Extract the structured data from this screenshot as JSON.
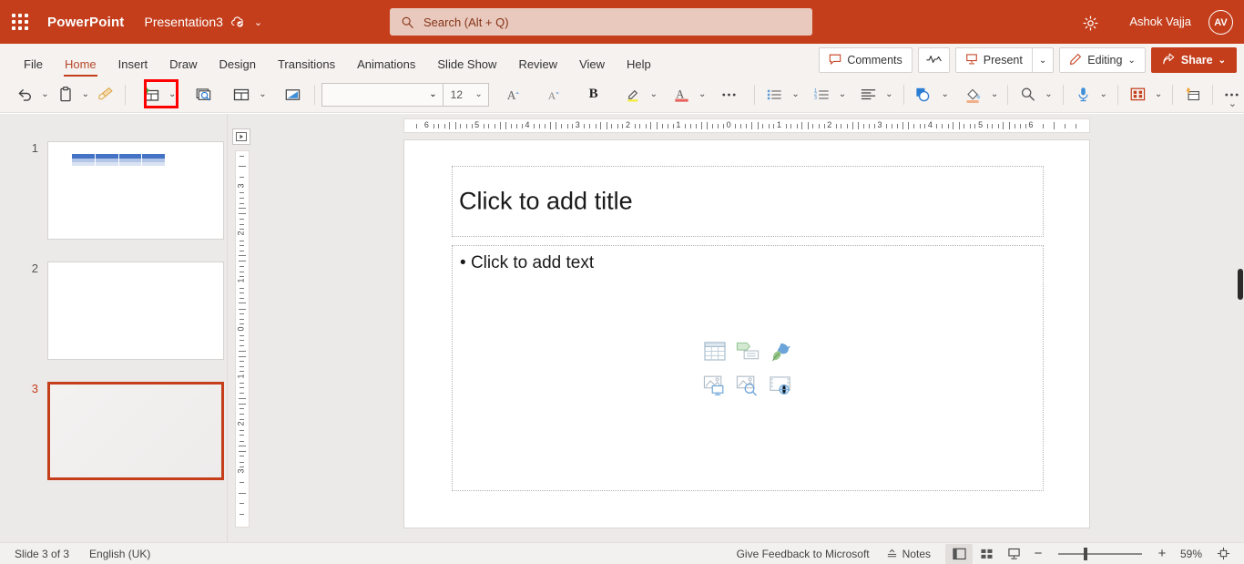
{
  "titlebar": {
    "app_name": "PowerPoint",
    "document_name": "Presentation3",
    "cloud_status_icon": "cloud-saved-icon",
    "title_chevron": "⌄",
    "search": {
      "placeholder": "Search (Alt + Q)",
      "icon": "search-icon"
    },
    "settings_icon": "gear-icon",
    "user_name": "Ashok Vajja",
    "avatar_initials": "AV"
  },
  "ribbon": {
    "tabs": [
      {
        "label": "File",
        "active": false
      },
      {
        "label": "Home",
        "active": true
      },
      {
        "label": "Insert",
        "active": false
      },
      {
        "label": "Draw",
        "active": false
      },
      {
        "label": "Design",
        "active": false
      },
      {
        "label": "Transitions",
        "active": false
      },
      {
        "label": "Animations",
        "active": false
      },
      {
        "label": "Slide Show",
        "active": false
      },
      {
        "label": "Review",
        "active": false
      },
      {
        "label": "View",
        "active": false
      },
      {
        "label": "Help",
        "active": false
      }
    ],
    "right_buttons": {
      "comments": "Comments",
      "activity_icon": "activity-pulse-icon",
      "present": "Present",
      "present_chevron": "⌄",
      "editing": "Editing",
      "editing_chevron": "⌄",
      "share": "Share",
      "share_chevron": "⌄"
    },
    "collapse_chevron": "⌄"
  },
  "toolbar": {
    "items": [
      {
        "name": "undo-button",
        "icon": "undo-icon",
        "has_dropdown": true
      },
      {
        "name": "paste-button",
        "icon": "clipboard-icon",
        "has_dropdown": true
      },
      {
        "name": "format-painter-button",
        "icon": "paintbrush-icon",
        "has_dropdown": false
      },
      {
        "name": "new-slide-button",
        "icon": "new-slide-icon",
        "has_dropdown": true,
        "highlighted": true
      },
      {
        "name": "reuse-slides-button",
        "icon": "slide-search-icon",
        "has_dropdown": false
      },
      {
        "name": "layout-button",
        "icon": "slide-layout-icon",
        "has_dropdown": true
      },
      {
        "name": "reset-button",
        "icon": "reset-slide-icon",
        "has_dropdown": false
      }
    ],
    "font_name": "",
    "font_size": "12",
    "grow_font_icon": "increase-font-size-icon",
    "shrink_font_icon": "decrease-font-size-icon",
    "bold_label": "B",
    "highlight_icon": "text-highlight-icon",
    "font_color_icon": "font-color-icon",
    "more_font_icon": "more-options-ellipsis",
    "bullets_icon": "bullet-list-icon",
    "numbering_icon": "numbered-list-icon",
    "align_icon": "align-left-icon",
    "shapes_icon": "shapes-icon",
    "fill_icon": "shape-fill-icon",
    "find_icon": "find-icon",
    "dictate_icon": "microphone-icon",
    "designer_icon": "designer-grid-icon",
    "record_icon": "record-slideshow-icon",
    "more_icon": "more-options-ellipsis"
  },
  "thumbnails": {
    "slides": [
      {
        "number": "1",
        "selected": false,
        "has_table": true
      },
      {
        "number": "2",
        "selected": false,
        "has_table": false
      },
      {
        "number": "3",
        "selected": true,
        "has_table": false
      }
    ]
  },
  "rulers": {
    "horizontal_labels": [
      "6",
      "5",
      "4",
      "3",
      "2",
      "1",
      "0",
      "1",
      "2",
      "3",
      "4",
      "5",
      "6"
    ],
    "vertical_labels": [
      "3",
      "2",
      "1",
      "0",
      "1",
      "2",
      "3"
    ],
    "ruler_toggle_icon": "ruler-toggle-icon"
  },
  "slide": {
    "title_placeholder": "Click to add title",
    "body_bullet": "•",
    "body_placeholder": "Click to add text",
    "content_icons": [
      "insert-table-icon",
      "insert-smartart-icon",
      "insert-icons-icon",
      "insert-3d-model-icon",
      "insert-stock-images-icon",
      "insert-video-icon"
    ]
  },
  "statusbar": {
    "slide_count": "Slide 3 of 3",
    "language": "English (UK)",
    "feedback": "Give Feedback to Microsoft",
    "notes_label": "Notes",
    "notes_icon": "notes-icon",
    "view_normal_icon": "normal-view-icon",
    "view_sorter_icon": "slide-sorter-icon",
    "view_reading_icon": "reading-view-icon",
    "zoom_out_label": "−",
    "zoom_in_label": "+",
    "zoom_value": "59%",
    "fit_slide_icon": "fit-slide-to-window-icon"
  },
  "colors": {
    "brand": "#c43e1c",
    "accent_text": "#b7472a",
    "highlight_box": "#ff0000",
    "search_bg": "#e9c8bd",
    "chrome_bg": "#f5f2f0",
    "pane_bg": "#eceae8"
  }
}
